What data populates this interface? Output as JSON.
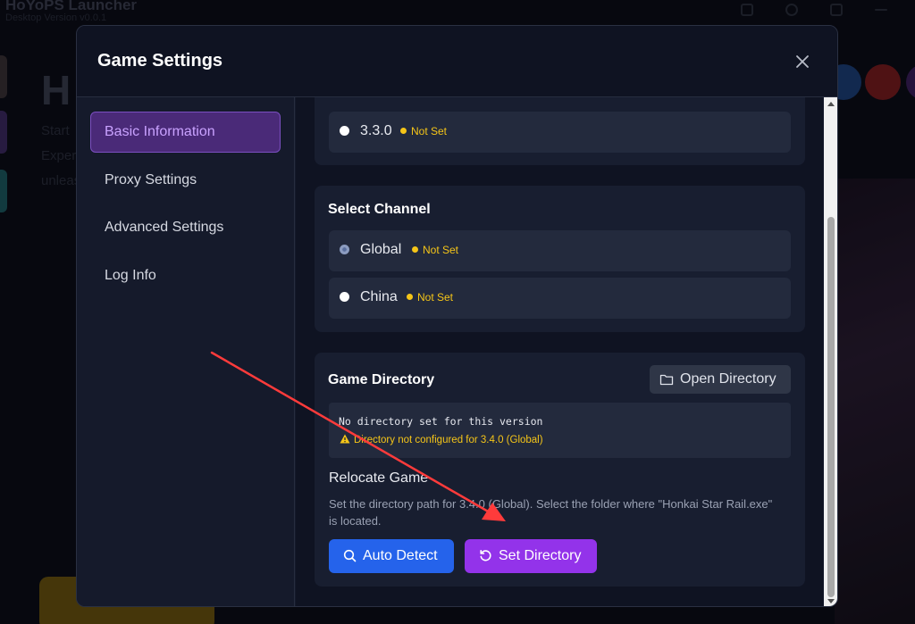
{
  "background": {
    "app_title": "HoYoPS Launcher",
    "app_subtitle": "Desktop Version v0.0.1",
    "hero_title": "H",
    "hero_lines": [
      "Start",
      "Exper",
      "unleas"
    ]
  },
  "modal": {
    "title": "Game Settings",
    "close_icon": "close-icon"
  },
  "sidebar": {
    "items": [
      {
        "label": "Basic Information",
        "active": true
      },
      {
        "label": "Proxy Settings",
        "active": false
      },
      {
        "label": "Advanced Settings",
        "active": false
      },
      {
        "label": "Log Info",
        "active": false
      }
    ]
  },
  "version_section": {
    "options": [
      {
        "label": "3.3.0",
        "status": "Not Set",
        "selected": false
      }
    ]
  },
  "channel_section": {
    "title": "Select Channel",
    "options": [
      {
        "label": "Global",
        "status": "Not Set",
        "selected": true
      },
      {
        "label": "China",
        "status": "Not Set",
        "selected": false
      }
    ]
  },
  "directory_section": {
    "title": "Game Directory",
    "open_button": "Open Directory",
    "status_text": "No directory set for this version",
    "warning_text": "Directory not configured for 3.4.0 (Global)",
    "relocate_title": "Relocate Game",
    "relocate_description": "Set the directory path for 3.4.0 (Global). Select the folder where \"Honkai Star Rail.exe\" is located.",
    "auto_detect_button": "Auto Detect",
    "set_directory_button": "Set Directory"
  },
  "colors": {
    "accent_purple": "#9333ea",
    "accent_blue": "#2563eb",
    "warning_yellow": "#f5c518",
    "annotation_red": "#ff3b3b"
  }
}
